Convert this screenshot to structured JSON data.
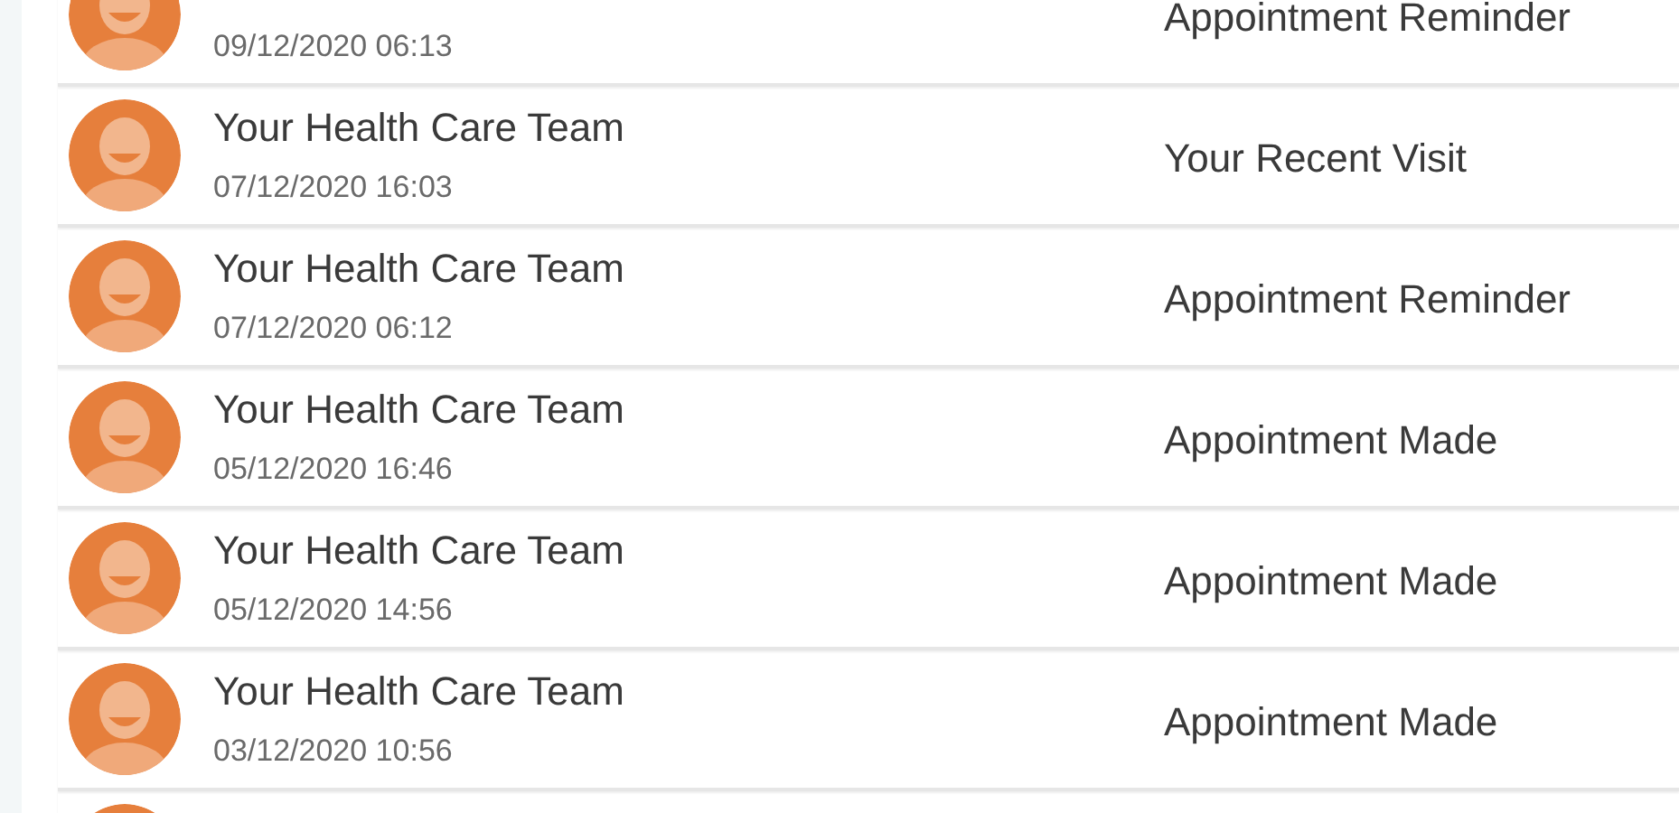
{
  "messages": [
    {
      "kind": "message",
      "date": "09/12/2020 06:13",
      "subject": "Appointment Reminder"
    },
    {
      "kind": "message",
      "sender": "Your Health Care Team",
      "date": "07/12/2020 16:03",
      "subject": "Your Recent Visit"
    },
    {
      "kind": "message",
      "sender": "Your Health Care Team",
      "date": "07/12/2020 06:12",
      "subject": "Appointment Reminder"
    },
    {
      "kind": "message",
      "sender": "Your Health Care Team",
      "date": "05/12/2020 16:46",
      "subject": "Appointment Made"
    },
    {
      "kind": "message",
      "sender": "Your Health Care Team",
      "date": "05/12/2020 14:56",
      "subject": "Appointment Made"
    },
    {
      "kind": "message",
      "sender": "Your Health Care Team",
      "date": "03/12/2020 10:56",
      "subject": "Appointment Made"
    },
    {
      "kind": "avatar_only"
    }
  ]
}
